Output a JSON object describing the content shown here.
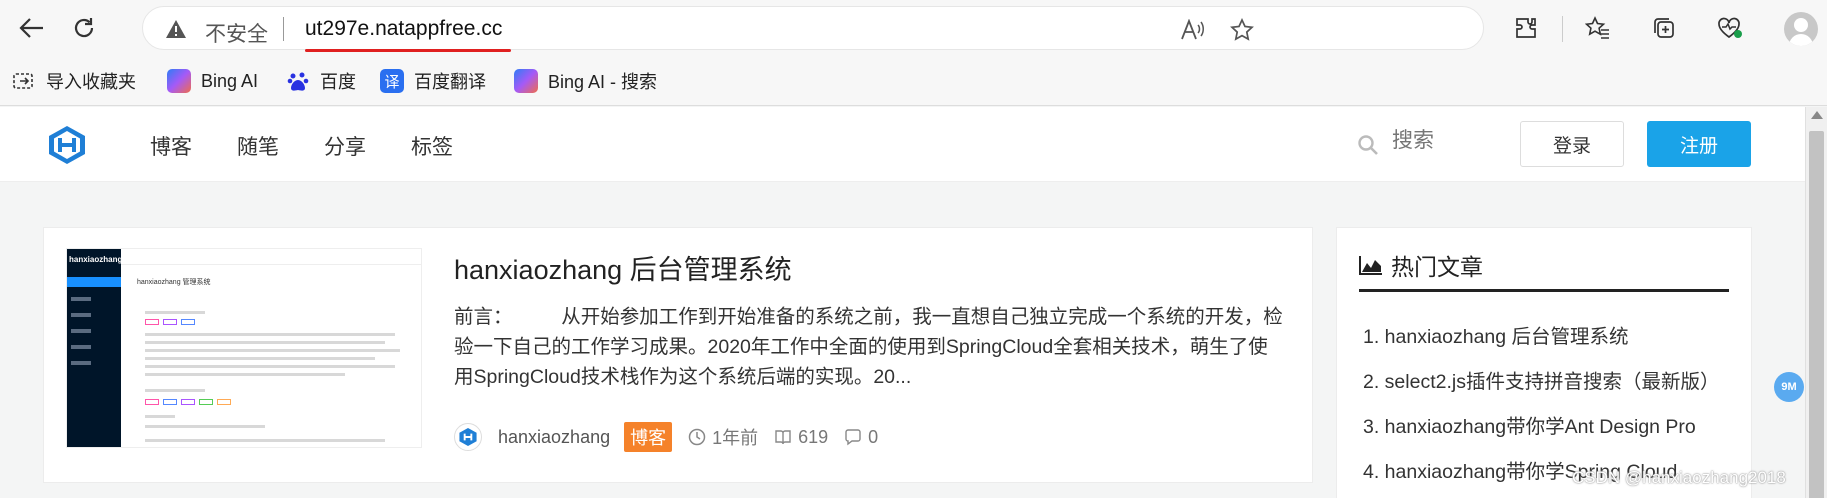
{
  "browser": {
    "security_label": "不安全",
    "url": "ut297e.natappfree.cc",
    "icons": [
      "back-arrow-icon",
      "refresh-icon",
      "warning-icon",
      "read-aloud-icon",
      "star-icon",
      "extensions-icon",
      "favorites-icon",
      "collections-icon",
      "browser-essentials-icon",
      "profile-avatar"
    ]
  },
  "favorites": [
    {
      "label": "导入收藏夹",
      "icon": "import-favorites-icon"
    },
    {
      "label": "Bing AI",
      "icon": "bing-icon"
    },
    {
      "label": "百度",
      "icon": "baidu-icon"
    },
    {
      "label": "百度翻译",
      "icon": "translate-icon"
    },
    {
      "label": "Bing AI - 搜索",
      "icon": "bing-icon"
    }
  ],
  "site": {
    "nav": [
      "博客",
      "随笔",
      "分享",
      "标签"
    ],
    "search_placeholder": "搜索",
    "login_label": "登录",
    "register_label": "注册",
    "accent_color": "#1aa3e8"
  },
  "article": {
    "title": "hanxiaozhang 后台管理系统",
    "excerpt": "前言：　　　从开始参加工作到开始准备的系统之前，我一直想自己独立完成一个系统的开发，检验一下自己的工作学习成果。2020年工作中全面的使用到SpringCloud全套相关技术，萌生了使用SpringCloud技术栈作为这个系统后端的实现。20...",
    "author": "hanxiaozhang",
    "badge": "博客",
    "time": "1年前",
    "views": "619",
    "comments": "0",
    "thumbnail": {
      "brand": "hanxiaozhang",
      "page_title": "hanxiaozhang 管理系统"
    }
  },
  "sidebar": {
    "title": "热门文章",
    "items": [
      "1. hanxiaozhang 后台管理系统",
      "2. select2.js插件支持拼音搜索（最新版）",
      "3. hanxiaozhang带你学Ant Design Pro",
      "4. hanxiaozhang带你学Spring Cloud"
    ]
  },
  "float_badge": "9M",
  "watermark": "CSDN @hanxiaozhang2018"
}
